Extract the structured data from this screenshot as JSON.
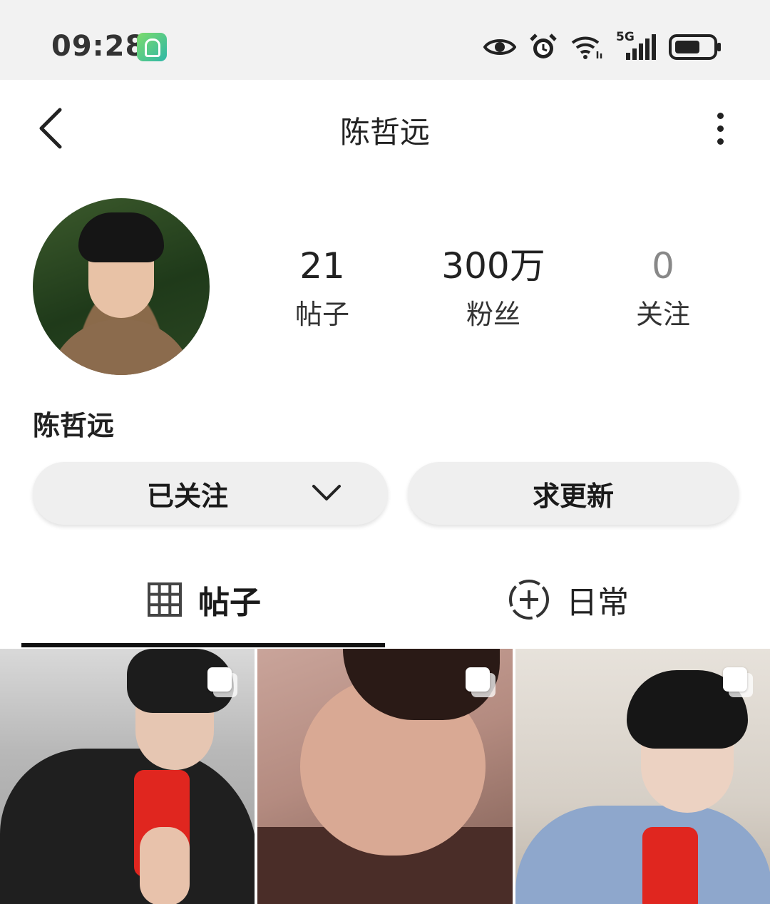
{
  "status_bar": {
    "time": "09:28",
    "network_label": "5G"
  },
  "header": {
    "title": "陈哲远"
  },
  "profile": {
    "stats": [
      {
        "value": "21",
        "label": "帖子"
      },
      {
        "value": "300万",
        "label": "粉丝"
      },
      {
        "value": "0",
        "label": "关注"
      }
    ],
    "name": "陈哲远",
    "follow_button_label": "已关注",
    "request_update_label": "求更新"
  },
  "tabs": [
    {
      "label": "帖子",
      "icon": "grid-icon",
      "active": true
    },
    {
      "label": "日常",
      "icon": "dashed-plus-circle-icon",
      "active": false
    }
  ],
  "colors": {
    "phone_case": "#e0261f",
    "status_bar_bg": "#f2f2f2",
    "button_bg": "#efefef"
  }
}
